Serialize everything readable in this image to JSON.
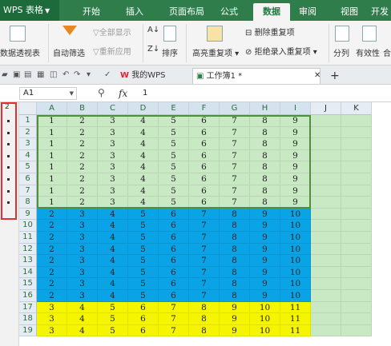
{
  "app": {
    "title": "WPS 表格"
  },
  "menu_tabs": [
    "开始",
    "插入",
    "页面布局",
    "公式",
    "数据",
    "审阅",
    "视图",
    "开发"
  ],
  "active_menu": "数据",
  "ribbon": {
    "pivot_table": "数据透视表",
    "auto_filter": "自动筛选",
    "show_all": "全部显示",
    "reapply": "重新应用",
    "sort": "排序",
    "highlight_dup": "高亮重复项",
    "delete_dup": "删除重复项",
    "reject_dup_entry": "拒绝录入重复项",
    "split": "分列",
    "validity": "有效性",
    "merge_calc": "合并"
  },
  "doc_tabs": [
    {
      "label": "我的WPS",
      "active": false
    },
    {
      "label": "工作簿1 *",
      "active": true
    }
  ],
  "formula_bar": {
    "name_box": "A1",
    "fx": "fx",
    "value": "1"
  },
  "outline": {
    "level_label": "2"
  },
  "columns": [
    "A",
    "B",
    "C",
    "D",
    "E",
    "F",
    "G",
    "H",
    "I",
    "J",
    "K"
  ],
  "rows": [
    {
      "row": "1",
      "cells": [
        "1",
        "2",
        "3",
        "4",
        "5",
        "6",
        "7",
        "8",
        "9"
      ]
    },
    {
      "row": "2",
      "cells": [
        "1",
        "2",
        "3",
        "4",
        "5",
        "6",
        "7",
        "8",
        "9"
      ]
    },
    {
      "row": "3",
      "cells": [
        "1",
        "2",
        "3",
        "4",
        "5",
        "6",
        "7",
        "8",
        "9"
      ]
    },
    {
      "row": "4",
      "cells": [
        "1",
        "2",
        "3",
        "4",
        "5",
        "6",
        "7",
        "8",
        "9"
      ]
    },
    {
      "row": "5",
      "cells": [
        "1",
        "2",
        "3",
        "4",
        "5",
        "6",
        "7",
        "8",
        "9"
      ]
    },
    {
      "row": "6",
      "cells": [
        "1",
        "2",
        "3",
        "4",
        "5",
        "6",
        "7",
        "8",
        "9"
      ]
    },
    {
      "row": "7",
      "cells": [
        "1",
        "2",
        "3",
        "4",
        "5",
        "6",
        "7",
        "8",
        "9"
      ]
    },
    {
      "row": "8",
      "cells": [
        "1",
        "2",
        "3",
        "4",
        "5",
        "6",
        "7",
        "8",
        "9"
      ]
    },
    {
      "row": "9",
      "cells": [
        "2",
        "3",
        "4",
        "5",
        "6",
        "7",
        "8",
        "9",
        "10"
      ]
    },
    {
      "row": "10",
      "cells": [
        "2",
        "3",
        "4",
        "5",
        "6",
        "7",
        "8",
        "9",
        "10"
      ]
    },
    {
      "row": "11",
      "cells": [
        "2",
        "3",
        "4",
        "5",
        "6",
        "7",
        "8",
        "9",
        "10"
      ]
    },
    {
      "row": "12",
      "cells": [
        "2",
        "3",
        "4",
        "5",
        "6",
        "7",
        "8",
        "9",
        "10"
      ]
    },
    {
      "row": "13",
      "cells": [
        "2",
        "3",
        "4",
        "5",
        "6",
        "7",
        "8",
        "9",
        "10"
      ]
    },
    {
      "row": "14",
      "cells": [
        "2",
        "3",
        "4",
        "5",
        "6",
        "7",
        "8",
        "9",
        "10"
      ]
    },
    {
      "row": "15",
      "cells": [
        "2",
        "3",
        "4",
        "5",
        "6",
        "7",
        "8",
        "9",
        "10"
      ]
    },
    {
      "row": "16",
      "cells": [
        "2",
        "3",
        "4",
        "5",
        "6",
        "7",
        "8",
        "9",
        "10"
      ]
    },
    {
      "row": "17",
      "cells": [
        "3",
        "4",
        "5",
        "6",
        "7",
        "8",
        "9",
        "10",
        "11"
      ]
    },
    {
      "row": "18",
      "cells": [
        "3",
        "4",
        "5",
        "6",
        "7",
        "8",
        "9",
        "10",
        "11"
      ]
    },
    {
      "row": "19",
      "cells": [
        "3",
        "4",
        "5",
        "6",
        "7",
        "8",
        "9",
        "10",
        "11"
      ]
    }
  ],
  "colors": {
    "group1_fill": "#c9e8c4",
    "group2_fill": "#0aa3e6",
    "group3_fill": "#f5f500",
    "empty_fill": "#c9e8c4",
    "selection_border": "#4f8f3f",
    "outline_box": "#e03030",
    "menu_bar": "#2e7d4b"
  }
}
